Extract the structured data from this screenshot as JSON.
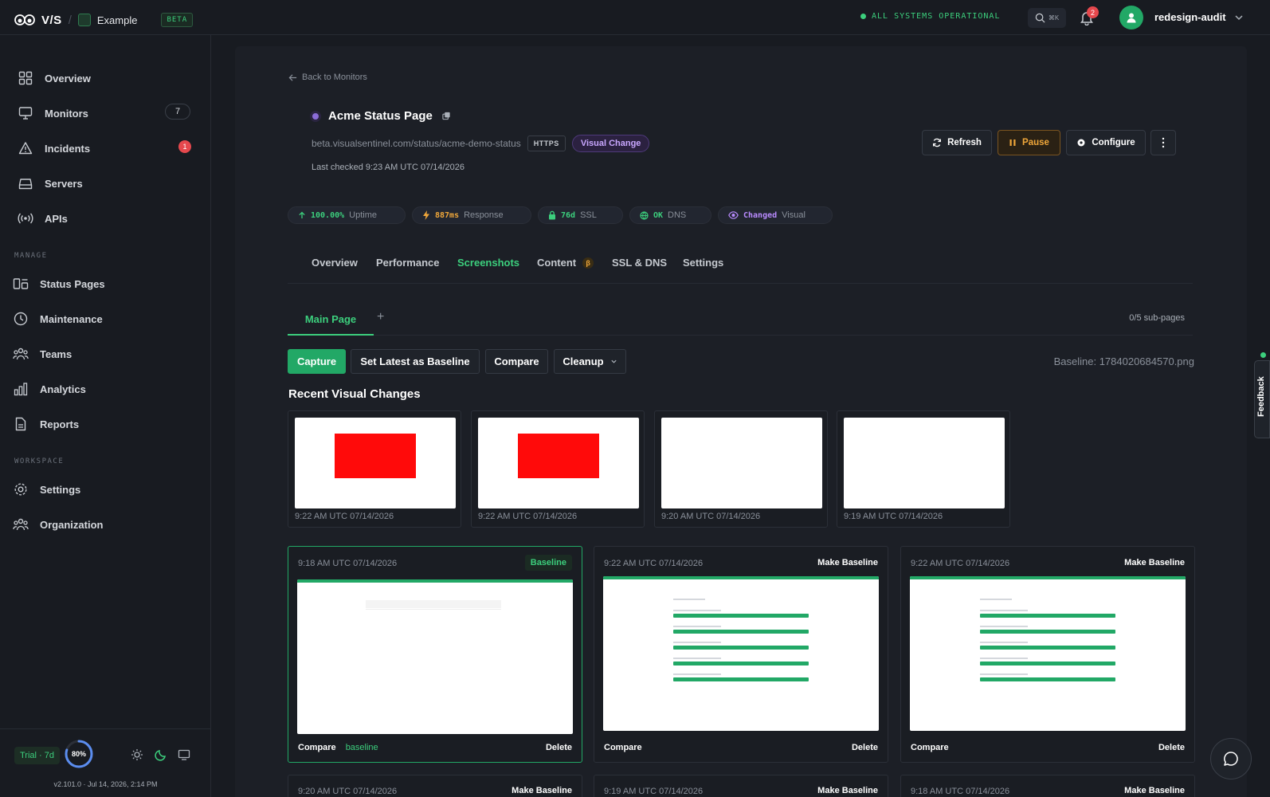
{
  "topbar": {
    "brand": "V/S",
    "org": "Example",
    "beta": "BETA",
    "system_status": "ALL SYSTEMS OPERATIONAL",
    "search_shortcut": "⌘K",
    "notifications": "2",
    "user": "redesign-audit"
  },
  "sidebar": {
    "items": [
      {
        "label": "Overview",
        "icon": "grid-icon"
      },
      {
        "label": "Monitors",
        "icon": "monitor-icon",
        "count": "7"
      },
      {
        "label": "Incidents",
        "icon": "warning-icon",
        "alert": "1"
      },
      {
        "label": "Servers",
        "icon": "server-icon"
      },
      {
        "label": "APIs",
        "icon": "broadcast-icon"
      }
    ],
    "manage_label": "MANAGE",
    "manage": [
      {
        "label": "Status Pages",
        "icon": "status-pages-icon"
      },
      {
        "label": "Maintenance",
        "icon": "clock-icon"
      },
      {
        "label": "Teams",
        "icon": "users-icon"
      },
      {
        "label": "Analytics",
        "icon": "bar-chart-icon"
      },
      {
        "label": "Reports",
        "icon": "document-icon"
      }
    ],
    "workspace_label": "WORKSPACE",
    "workspace": [
      {
        "label": "Settings",
        "icon": "gear-icon"
      },
      {
        "label": "Organization",
        "icon": "organization-icon"
      }
    ],
    "trial": "Trial · 7d",
    "usage_percent": "80%",
    "usage_fraction": 0.8,
    "version": "v2.101.0 · Jul 14, 2026, 2:14 PM"
  },
  "monitor": {
    "back": "Back to Monitors",
    "name": "Acme Status Page",
    "url": "beta.visualsentinel.com/status/acme-demo-status",
    "protocol": "HTTPS",
    "change_pill": "Visual Change",
    "last_checked": "Last checked 9:23 AM UTC 07/14/2026",
    "actions": {
      "refresh": "Refresh",
      "pause": "Pause",
      "configure": "Configure"
    }
  },
  "stats": [
    {
      "value": "100.00%",
      "label": "Uptime",
      "color": "#3ccf7d"
    },
    {
      "value": "887ms",
      "label": "Response",
      "color": "#f0a73a"
    },
    {
      "value": "76d",
      "label": "SSL",
      "color": "#3ccf7d"
    },
    {
      "value": "OK",
      "label": "DNS",
      "color": "#3ccf7d"
    },
    {
      "value": "Changed",
      "label": "Visual",
      "color": "#b98bff"
    }
  ],
  "tabs": [
    "Overview",
    "Performance",
    "Screenshots",
    "Content",
    "SSL & DNS",
    "Settings"
  ],
  "content_badge": "β",
  "active_tab": "Screenshots",
  "subtabs": {
    "main": "Main Page",
    "add": "+",
    "count": "0/5 sub-pages"
  },
  "toolbar": {
    "capture": "Capture",
    "set_baseline": "Set Latest as Baseline",
    "compare": "Compare",
    "cleanup": "Cleanup",
    "baseline_file": "Baseline: 1784020684570.png"
  },
  "recent_title": "Recent Visual Changes",
  "recent": [
    {
      "time": "9:22 AM UTC 07/14/2026",
      "diff": true
    },
    {
      "time": "9:22 AM UTC 07/14/2026",
      "diff": true
    },
    {
      "time": "9:20 AM UTC 07/14/2026",
      "diff": false
    },
    {
      "time": "9:19 AM UTC 07/14/2026",
      "diff": false
    }
  ],
  "screenshots": [
    {
      "time": "9:18 AM UTC 07/14/2026",
      "baseline_badge": "Baseline",
      "compare": "Compare",
      "baseline_link": "baseline",
      "delete": "Delete"
    },
    {
      "time": "9:22 AM UTC 07/14/2026",
      "make_baseline": "Make Baseline",
      "compare": "Compare",
      "delete": "Delete"
    },
    {
      "time": "9:22 AM UTC 07/14/2026",
      "make_baseline": "Make Baseline",
      "compare": "Compare",
      "delete": "Delete"
    }
  ],
  "screenshots_row2": [
    {
      "time": "9:20 AM UTC 07/14/2026",
      "make_baseline": "Make Baseline"
    },
    {
      "time": "9:19 AM UTC 07/14/2026",
      "make_baseline": "Make Baseline"
    },
    {
      "time": "9:18 AM UTC 07/14/2026",
      "make_baseline": "Make Baseline"
    }
  ],
  "feedback": "Feedback",
  "colors": {
    "accent": "#22a866",
    "accent_text": "#3ccf7d",
    "warning": "#f0a73a",
    "danger": "#e5484d",
    "purple": "#b98bff"
  }
}
